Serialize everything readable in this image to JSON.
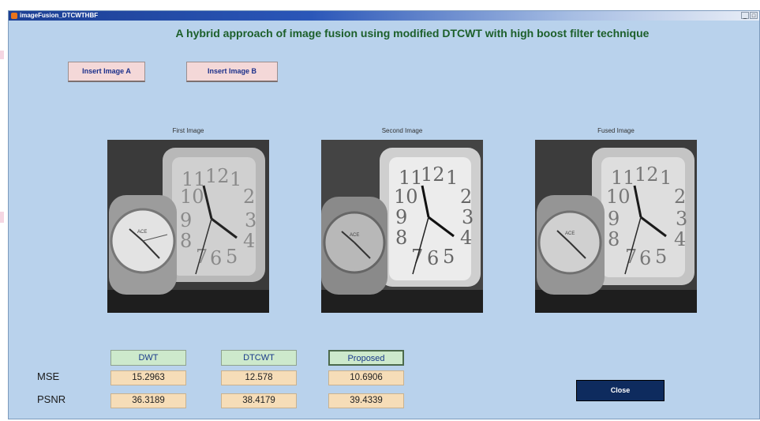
{
  "window": {
    "title": "imageFusion_DTCWTHBF",
    "minimize_label": "_",
    "maximize_label": "□"
  },
  "heading": "A hybrid approach of image fusion using modified DTCWT with high boost filter technique",
  "buttons": {
    "insert_a": "Insert Image A",
    "insert_b": "Insert Image B",
    "close": "Close"
  },
  "images": [
    {
      "caption": "First Image"
    },
    {
      "caption": "Second Image"
    },
    {
      "caption": "Fused Image"
    }
  ],
  "metrics": {
    "columns": [
      "DWT",
      "DTCWT",
      "Proposed"
    ],
    "rows": [
      {
        "label": "MSE",
        "values": [
          "15.2963",
          "12.578",
          "10.6906"
        ]
      },
      {
        "label": "PSNR",
        "values": [
          "36.3189",
          "38.4179",
          "39.4339"
        ]
      }
    ]
  },
  "colors": {
    "background": "#b9d2ec",
    "header_green": "#cde9cc",
    "value_peach": "#f6ddb8",
    "insert_pink": "#f4d8d8",
    "close_navy": "#0e2b5e"
  }
}
